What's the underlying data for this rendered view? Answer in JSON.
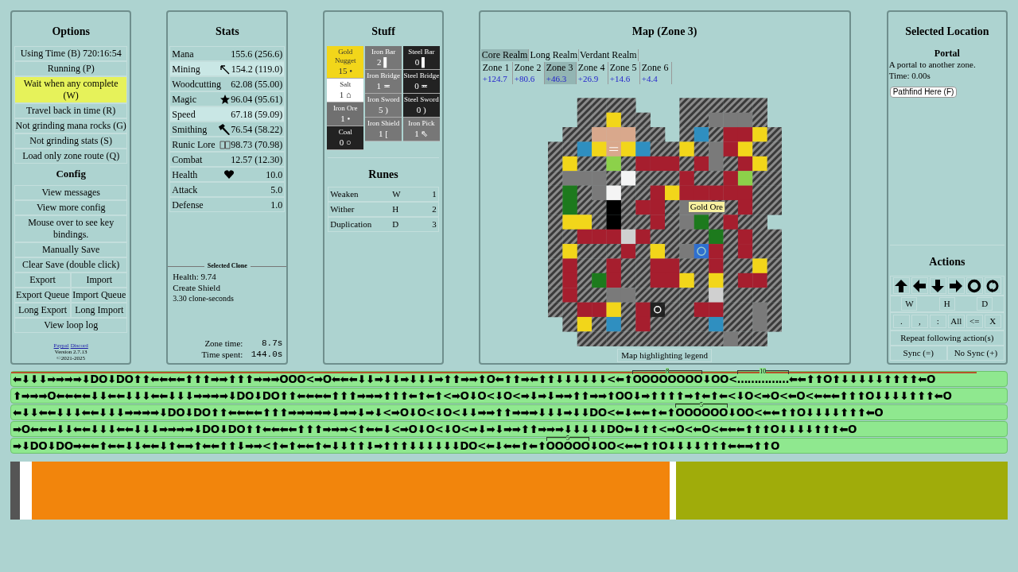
{
  "options": {
    "title": "Options",
    "rows": [
      {
        "items": [
          {
            "label": "Using Time (B) 720:16:54",
            "highlighted": false
          }
        ]
      },
      {
        "items": [
          {
            "label": "Running (P)",
            "highlighted": false
          }
        ]
      },
      {
        "items": [
          {
            "label": "Wait when any complete (W)",
            "highlighted": true
          }
        ]
      },
      {
        "items": [
          {
            "label": "Travel back in time (R)",
            "highlighted": false
          }
        ]
      },
      {
        "items": [
          {
            "label": "Not grinding mana rocks (G)",
            "highlighted": false
          }
        ]
      },
      {
        "items": [
          {
            "label": "Not grinding stats (S)",
            "highlighted": false
          }
        ]
      },
      {
        "items": [
          {
            "label": "Load only zone route (Q)",
            "highlighted": false
          }
        ]
      }
    ]
  },
  "config": {
    "title": "Config",
    "rows": [
      {
        "items": [
          {
            "label": "View messages"
          }
        ]
      },
      {
        "items": [
          {
            "label": "View more config"
          }
        ]
      },
      {
        "items": [
          {
            "label": "Mouse over to see key bindings."
          }
        ]
      },
      {
        "items": [
          {
            "label": "Manually Save"
          }
        ]
      },
      {
        "items": [
          {
            "label": "Clear Save (double click)"
          }
        ]
      },
      {
        "items": [
          {
            "label": "Export"
          },
          {
            "label": "Import"
          }
        ]
      },
      {
        "items": [
          {
            "label": "Export Queue"
          },
          {
            "label": "Import Queue"
          }
        ]
      },
      {
        "items": [
          {
            "label": "Long Export"
          },
          {
            "label": "Long Import"
          }
        ]
      },
      {
        "items": [
          {
            "label": "View loop log"
          }
        ]
      }
    ],
    "links": [
      "Paypal",
      "Discord"
    ],
    "version": "Version 2.7.13",
    "copyright": "©2021-2025"
  },
  "stats": {
    "title": "Stats",
    "rows": [
      {
        "name": "Mana",
        "kind": "none",
        "value": "155.6 (256.6)",
        "highlighted": false
      },
      {
        "name": "Mining",
        "kind": "pick",
        "value": "154.2 (119.0)",
        "highlighted": true
      },
      {
        "name": "Woodcutting",
        "kind": "none",
        "value": "62.08 (55.00)",
        "highlighted": false
      },
      {
        "name": "Magic",
        "kind": "star",
        "value": "96.04 (95.61)",
        "highlighted": false
      },
      {
        "name": "Speed",
        "kind": "none",
        "value": "67.18 (59.09)",
        "highlighted": true
      },
      {
        "name": "Smithing",
        "kind": "hammer",
        "value": "76.54 (58.22)",
        "highlighted": false
      },
      {
        "name": "Runic Lore",
        "kind": "book",
        "value": "98.73 (70.98)",
        "highlighted": false
      },
      {
        "name": "Combat",
        "kind": "none",
        "value": "12.57 (12.30)",
        "highlighted": false
      },
      {
        "name": "Health",
        "kind": "heart",
        "value": "10.0",
        "highlighted": false
      },
      {
        "name": "Attack",
        "kind": "none",
        "value": "5.0",
        "highlighted": false
      },
      {
        "name": "Defense",
        "kind": "none",
        "value": "1.0",
        "highlighted": false
      }
    ],
    "clone": {
      "title": "Selected Clone",
      "health": "Health: 9.74",
      "action": "Create Shield",
      "cost": "3.30 clone-seconds"
    },
    "zone_time": {
      "label": "Zone time:",
      "value": "8.7s"
    },
    "time_spent": {
      "label": "Time spent:",
      "value": "144.0s"
    }
  },
  "stuff": {
    "title": "Stuff",
    "columns": [
      [
        {
          "name": "Gold Nugget",
          "count": "15 •",
          "color": "#f2d61a"
        },
        {
          "name": "Salt",
          "count": "1 ⌂",
          "color": "#ffffff"
        },
        {
          "name": "Iron Ore",
          "count": "1 •",
          "color": "#707070"
        },
        {
          "name": "Coal",
          "count": "0 ○",
          "color": "#222222"
        }
      ],
      [
        {
          "name": "Iron Bar",
          "count": "2 ▌",
          "color": "#777777"
        },
        {
          "name": "Iron Bridge",
          "count": "1 ≖",
          "color": "#777777"
        },
        {
          "name": "Iron Sword",
          "count": "5 )",
          "color": "#777777"
        },
        {
          "name": "Iron Shield",
          "count": "1 [",
          "color": "#777777"
        }
      ],
      [
        {
          "name": "Steel Bar",
          "count": "0 ▌",
          "color": "#222222"
        },
        {
          "name": "Steel Bridge",
          "count": "0 ≖",
          "color": "#222222"
        },
        {
          "name": "Steel Sword",
          "count": "0 )",
          "color": "#222222"
        },
        {
          "name": "Iron Pick",
          "count": "1 ⇖",
          "color": "#777777"
        }
      ]
    ]
  },
  "runes": {
    "title": "Runes",
    "rows": [
      {
        "name": "Weaken",
        "key": "W",
        "count": "1"
      },
      {
        "name": "Wither",
        "key": "H",
        "count": "2"
      },
      {
        "name": "Duplication",
        "key": "D",
        "count": "3"
      }
    ]
  },
  "map": {
    "title": "Map (Zone 3)",
    "realms": [
      {
        "label": "Core Realm",
        "selected": true
      },
      {
        "label": "Long Realm",
        "selected": false
      },
      {
        "label": "Verdant Realm",
        "selected": false
      }
    ],
    "zones": [
      {
        "label": "Zone 1",
        "value": "+124.7",
        "selected": false
      },
      {
        "label": "Zone 2",
        "value": "+80.6",
        "selected": false
      },
      {
        "label": "Zone 3",
        "value": "+46.3",
        "selected": true
      },
      {
        "label": "Zone 4",
        "value": "+26.9",
        "selected": false
      },
      {
        "label": "Zone 5",
        "value": "+14.6",
        "selected": false
      },
      {
        "label": "Zone 6",
        "value": "+4.4",
        "selected": false
      }
    ],
    "tooltip": "Gold Ore",
    "legend": "Map highlighting legend"
  },
  "location": {
    "title": "Selected Location",
    "name": "Portal",
    "description": "A portal to another zone.",
    "time": "Time: 0.00s",
    "button": "Pathfind Here (F)"
  },
  "actions": {
    "title": "Actions",
    "moves": [
      {
        "kind": "up"
      },
      {
        "kind": "left"
      },
      {
        "kind": "down"
      },
      {
        "kind": "right"
      },
      {
        "kind": "interact"
      },
      {
        "kind": "sync"
      }
    ],
    "runes": [
      "W",
      "H",
      "D"
    ],
    "edits": [
      ".",
      ",",
      ":",
      "All",
      "<=",
      "X"
    ],
    "repeat": "Repeat following action(s)",
    "sync": [
      "Sync (=)",
      "No Sync (+)"
    ]
  },
  "queues": [
    {
      "level": 0.97,
      "segments": [
        {
          "kind": "actions",
          "text": "⬅⬇⬇⬇➡➡➡➡⬇DO⬇DO⬆⬆⬅⬅⬅⬅⬆⬆⬆➡➡⬆⬆⬆➡➡➡OOO<➡O⬅⬅⬅⬇⬇➡⬇⬇➡⬇⬇⬇➡⬆⬆➡➡⬆O⬅⬆⬆➡⬅⬆⬆⬇⬇⬇⬇⬇⬇<⬅⬆"
        },
        {
          "kind": "group",
          "label": "8",
          "text": "OOOOOOOO"
        },
        {
          "kind": "actions",
          "text": "⬇OO<"
        },
        {
          "kind": "group",
          "label": "10",
          "text": "……………"
        },
        {
          "kind": "actions",
          "text": "⬅⬅⬆⬆O⬆⬇⬇⬇⬇⬇⬆⬆⬆⬆⬅O"
        }
      ]
    },
    {
      "segments": [
        {
          "kind": "actions",
          "text": "⬆➡➡➡O⬅⬅⬅⬅⬇⬇⬅⬅⬇⬇⬇⬅⬅⬇⬇⬇➡➡➡➡⬇DO⬇DO⬆⬆⬅⬅⬅⬅⬆⬆⬆➡➡➡⬆⬆⬆⬅⬆⬅⬆<➡O⬇O<⬇O<➡⬇➡⬇➡➡⬆⬆➡➡⬆OO⬇➡⬆⬆⬆⬆➡⬆⬅⬆⬅<⬇O<➡O<⬅O<⬅⬅⬅⬆⬆⬆O⬇⬇⬇⬇⬆⬆⬆⬅O"
        }
      ]
    },
    {
      "segments": [
        {
          "kind": "actions",
          "text": "⬅⬇⬇⬅⬅⬇⬇⬇⬅⬅⬇⬇⬇➡➡➡➡⬇DO⬇DO⬆⬆⬅⬅⬅⬅⬆⬆⬆➡➡➡➡➡⬇➡➡⬇➡⬇<➡O⬇O<⬇O<⬇⬇➡➡⬆⬆➡➡➡⬇⬇⬇➡⬇⬇DO<⬅⬇⬅⬅⬆⬅⬆"
        },
        {
          "kind": "group",
          "label": "5",
          "text": "OOOOOO"
        },
        {
          "kind": "actions",
          "text": "⬇OO<⬅⬅⬆⬆O⬇⬇⬇⬇⬆⬆⬆⬅O"
        }
      ]
    },
    {
      "segments": [
        {
          "kind": "actions",
          "text": "➡O⬅⬅⬅⬇⬇⬅⬅⬇⬇⬇⬅⬅⬇⬇⬇➡➡➡➡⬇DO⬇DO⬆⬆⬅⬅⬅⬅⬆⬆⬆➡➡➡<⬆⬅⬅⬇<➡O⬇O<⬇O<➡⬇➡⬇➡➡⬆⬆➡➡➡⬇⬇⬇⬇⬇DO⬅⬇⬆⬆<➡O<⬅O<⬅⬅⬅⬆⬆⬆O⬇⬇⬇⬇⬆⬆⬆⬅O"
        }
      ]
    },
    {
      "segments": [
        {
          "kind": "actions",
          "text": "➡⬇DO⬇DO➡⬅⬅⬆⬅⬅⬇⬇⬅⬅⬇⬆⬅➡⬆⬅⬅⬆⬆⬇➡➡<⬆⬅⬆⬅⬅⬆⬅⬇⬇⬆⬆⬇➡⬆⬆⬆⬇⬇⬇⬇⬇⬇DO<⬅⬇⬅⬅⬆⬅⬆"
        },
        {
          "kind": "group",
          "label": "5",
          "text": "OOOOO"
        },
        {
          "kind": "actions",
          "text": "⬇OO<⬅⬅⬆⬆O⬇⬇⬇⬇⬆⬆⬆⬅⬅➡⬆⬆O"
        }
      ]
    }
  ],
  "timeline": [
    {
      "level": 0.66
    },
    {
      "level": 0.66
    },
    {
      "level": 0.66
    },
    {
      "level": 0.66
    },
    {
      "level": 0.66
    }
  ]
}
